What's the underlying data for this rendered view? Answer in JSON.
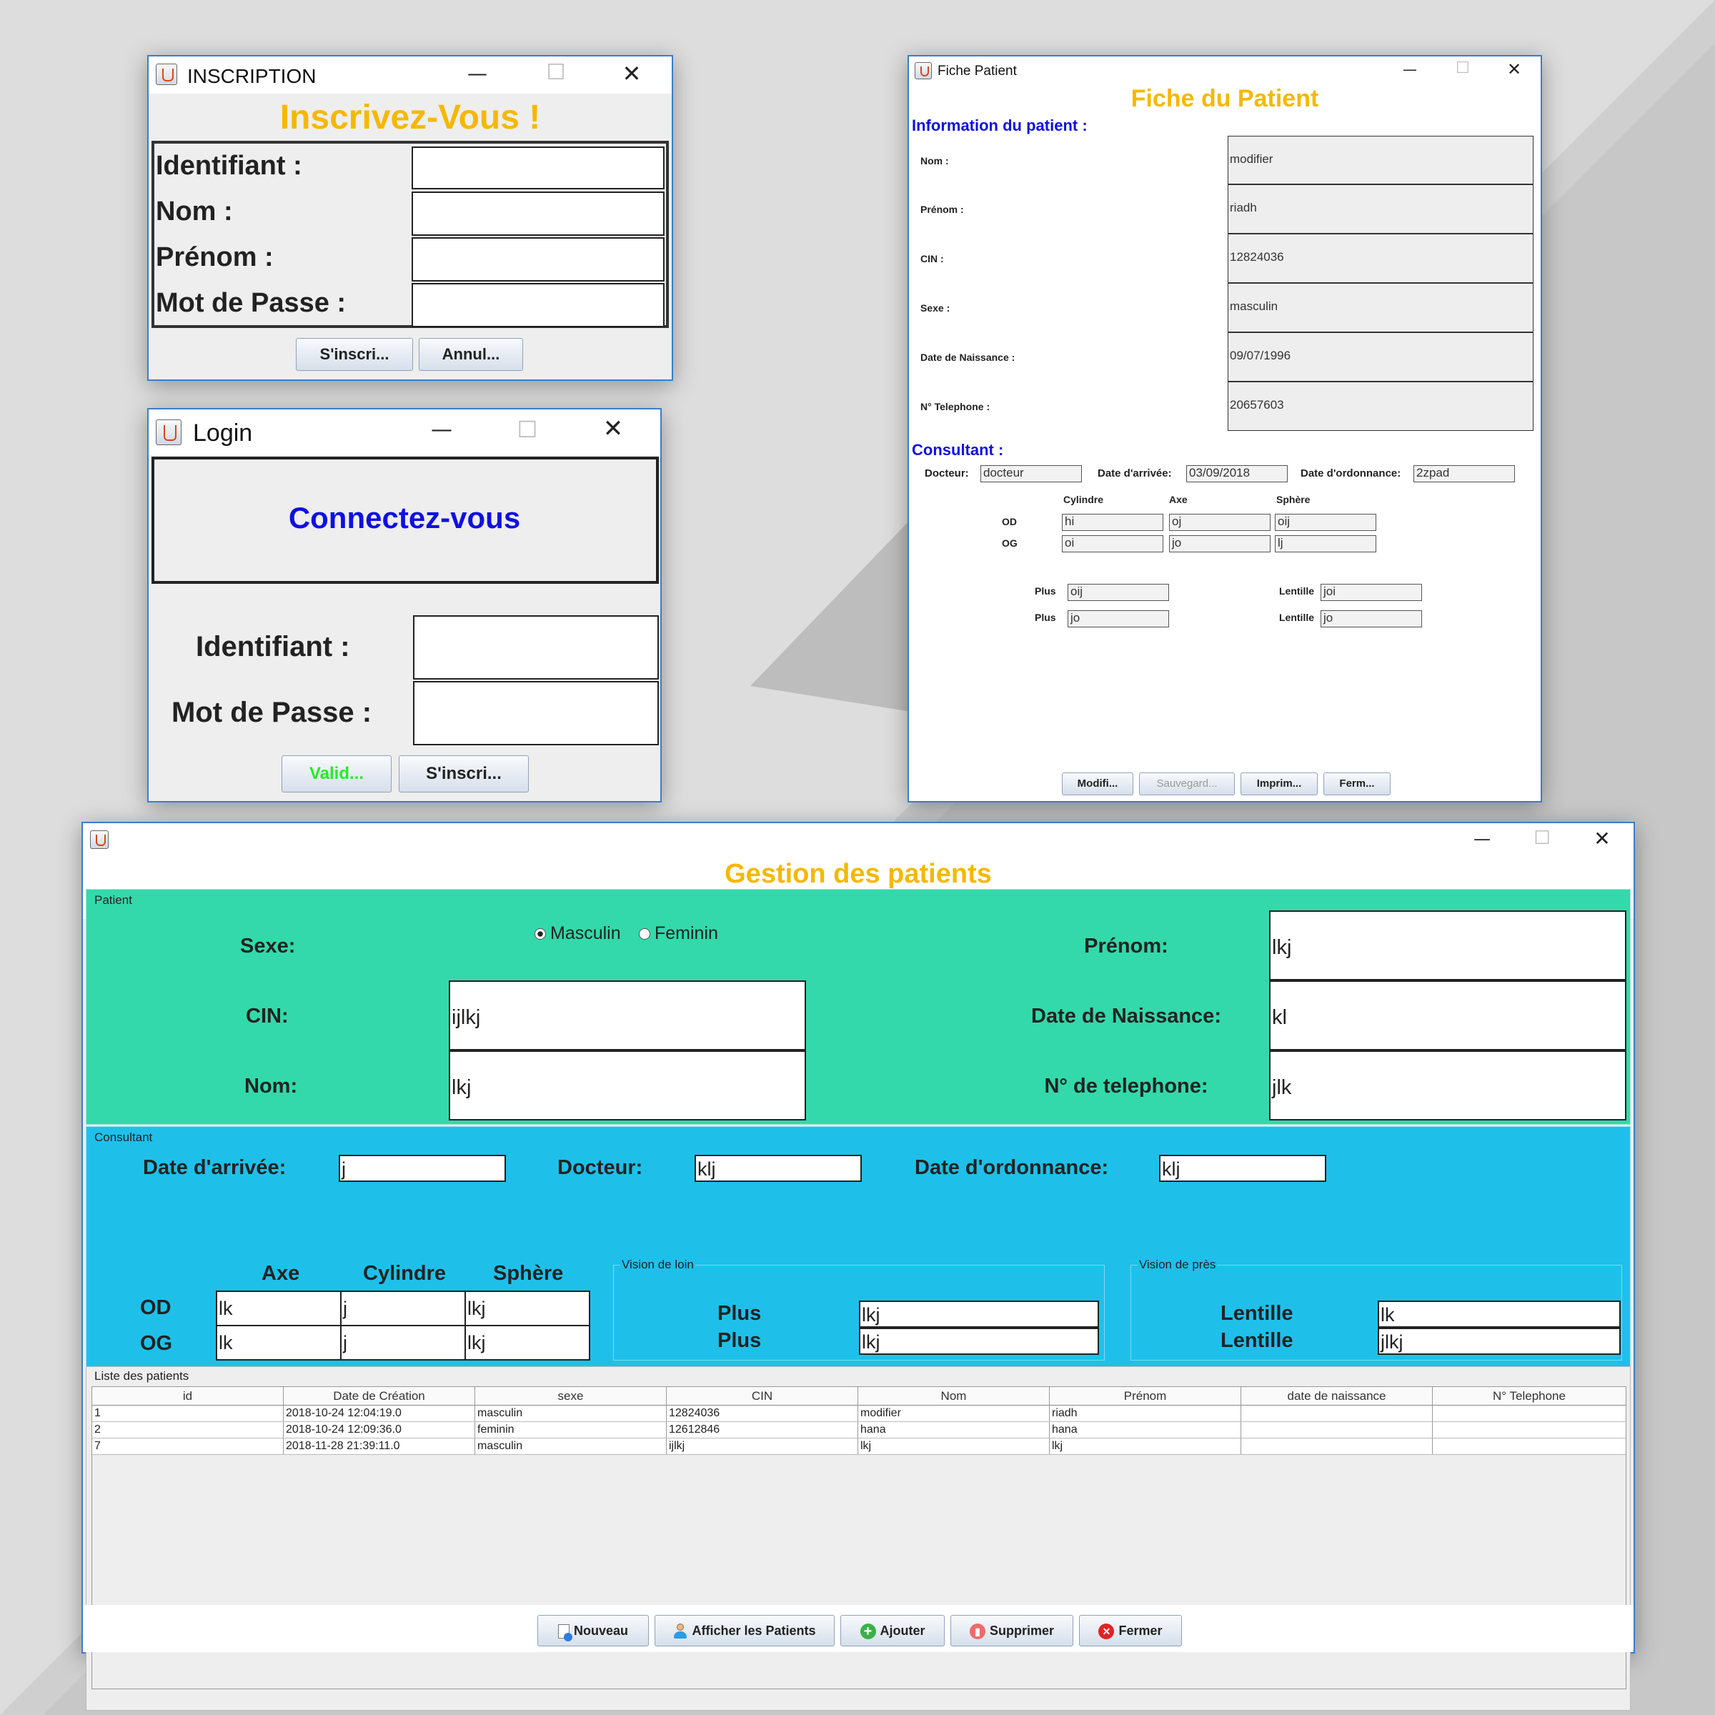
{
  "inscription": {
    "window_title": "INSCRIPTION",
    "heading": "Inscrivez-Vous !",
    "labels": [
      "Identifiant :",
      "Nom :",
      "Prénom :",
      "Mot de Passe :"
    ],
    "submit_label": "S'inscri...",
    "cancel_label": "Annul..."
  },
  "login": {
    "window_title": "Login",
    "heading": "Connectez-vous",
    "id_label": "Identifiant :",
    "password_label": "Mot de Passe :",
    "validate_label": "Valid...",
    "signup_label": "S'inscri..."
  },
  "fiche": {
    "window_title": "Fiche Patient",
    "heading": "Fiche du Patient",
    "info_section": "Information du patient :",
    "fields": [
      {
        "label": "Nom :",
        "value": "modifier"
      },
      {
        "label": "Prénom :",
        "value": "riadh"
      },
      {
        "label": "CIN :",
        "value": "12824036"
      },
      {
        "label": "Sexe :",
        "value": "masculin"
      },
      {
        "label": "Date de Naissance :",
        "value": "09/07/1996"
      },
      {
        "label": "N° Telephone :",
        "value": "20657603"
      }
    ],
    "consultant_section": "Consultant :",
    "docteur_label": "Docteur:",
    "docteur_value": "docteur",
    "arrivee_label": "Date d'arrivée:",
    "arrivee_value": "03/09/2018",
    "ordonnance_label": "Date d'ordonnance:",
    "ordonnance_value": "2zpad",
    "col_cylindre": "Cylindre",
    "col_axe": "Axe",
    "col_sphere": "Sphère",
    "od_label": "OD",
    "og_label": "OG",
    "od_values": [
      "hi",
      "oj",
      "oij"
    ],
    "og_values": [
      "oi",
      "jo",
      "lj"
    ],
    "plus_label": "Plus",
    "lentille_label": "Lentille",
    "plus_values": [
      "oij",
      "jo"
    ],
    "lentille_values": [
      "joi",
      "jo"
    ],
    "buttons": {
      "modifier": "Modifi...",
      "sauvegarder": "Sauvegard...",
      "imprimer": "Imprim...",
      "fermer": "Ferm..."
    }
  },
  "gestion": {
    "heading": "Gestion des patients",
    "patient_group": "Patient",
    "sexe_label": "Sexe:",
    "radio_masculin": "Masculin",
    "radio_feminin": "Feminin",
    "cin_label": "CIN:",
    "cin_value": "ijlkj",
    "nom_label": "Nom:",
    "nom_value": "lkj",
    "prenom_label": "Prénom:",
    "prenom_value": "lkj",
    "naissance_label": "Date de Naissance:",
    "naissance_value": "kl",
    "tel_label": "N° de telephone:",
    "tel_value": "jlk",
    "consultant_group": "Consultant",
    "arrivee_label": "Date d'arrivée:",
    "arrivee_value": "j",
    "docteur_label": "Docteur:",
    "docteur_value": "klj",
    "ordonnance_label": "Date d'ordonnance:",
    "ordonnance_value": "klj",
    "col_axe": "Axe",
    "col_cylindre": "Cylindre",
    "col_sphere": "Sphère",
    "od_label": "OD",
    "og_label": "OG",
    "od_values": [
      "lk",
      "j",
      "lkj"
    ],
    "og_values": [
      "lk",
      "j",
      "lkj"
    ],
    "vision_loin_group": "Vision de loin",
    "plus_label": "Plus",
    "plus_values": [
      "lkj",
      "lkj"
    ],
    "vision_pres_group": "Vision de près",
    "lentille_label": "Lentille",
    "lentille_values": [
      "lk",
      "jlkj"
    ],
    "list_group": "Liste des patients",
    "table": {
      "columns": [
        "id",
        "Date de Création",
        "sexe",
        "CIN",
        "Nom",
        "Prénom",
        "date de naissance",
        "N° Telephone"
      ],
      "rows": [
        [
          "1",
          "2018-10-24 12:04:19.0",
          "masculin",
          "12824036",
          "modifier",
          "riadh",
          "",
          ""
        ],
        [
          "2",
          "2018-10-24 12:09:36.0",
          "feminin",
          "12612846",
          "hana",
          "hana",
          "",
          ""
        ],
        [
          "7",
          "2018-11-28 21:39:11.0",
          "masculin",
          "ijlkj",
          "lkj",
          "lkj",
          "",
          ""
        ]
      ]
    },
    "buttons": {
      "nouveau": "Nouveau",
      "afficher": "Afficher les Patients",
      "ajouter": "Ajouter",
      "supprimer": "Supprimer",
      "fermer": "Fermer"
    }
  },
  "colors": {
    "heading_orange": "#f5b800",
    "heading_blue": "#1010e0",
    "patient_green": "#33d9aa",
    "consultant_blue": "#1ec0ea",
    "valid_green": "#22ee22"
  },
  "window_controls": {
    "minimize": "—",
    "maximize": "☐",
    "close": "✕"
  }
}
